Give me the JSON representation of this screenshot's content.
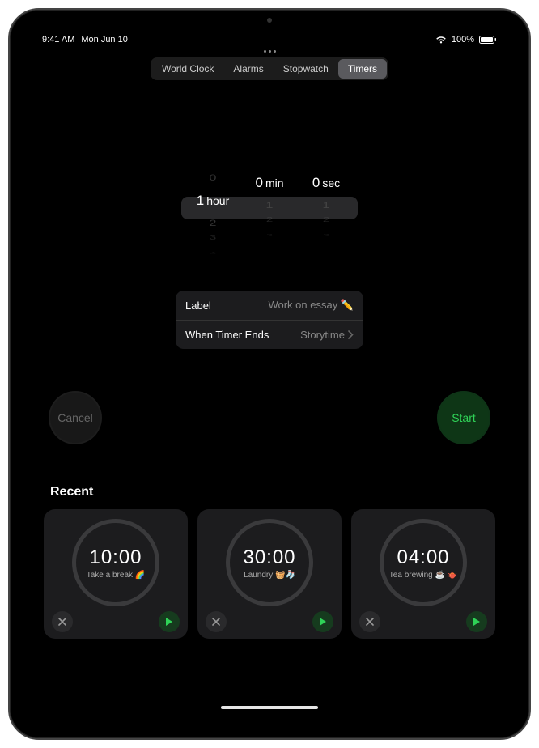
{
  "status": {
    "time": "9:41 AM",
    "date": "Mon Jun 10",
    "battery": "100%"
  },
  "tabs": {
    "items": [
      {
        "label": "World Clock"
      },
      {
        "label": "Alarms"
      },
      {
        "label": "Stopwatch"
      },
      {
        "label": "Timers"
      }
    ],
    "active": 3
  },
  "picker": {
    "hours": {
      "above1": "0",
      "selected": "1",
      "unit": "hour",
      "below1": "2",
      "below2": "3",
      "below3": "4"
    },
    "minutes": {
      "above1": "",
      "selected": "0",
      "unit": "min",
      "below1": "1",
      "below2": "2",
      "below3": "3"
    },
    "seconds": {
      "above1": "",
      "selected": "0",
      "unit": "sec",
      "below1": "1",
      "below2": "2",
      "below3": "3"
    }
  },
  "settings": {
    "label_title": "Label",
    "label_value": "Work on essay ✏️",
    "end_title": "When Timer Ends",
    "end_value": "Storytime"
  },
  "actions": {
    "cancel": "Cancel",
    "start": "Start"
  },
  "recent": {
    "title": "Recent",
    "cards": [
      {
        "time": "10:00",
        "label": "Take a break 🌈"
      },
      {
        "time": "30:00",
        "label": "Laundry 🧺🧦"
      },
      {
        "time": "04:00",
        "label": "Tea brewing ☕️ 🫖"
      }
    ]
  }
}
